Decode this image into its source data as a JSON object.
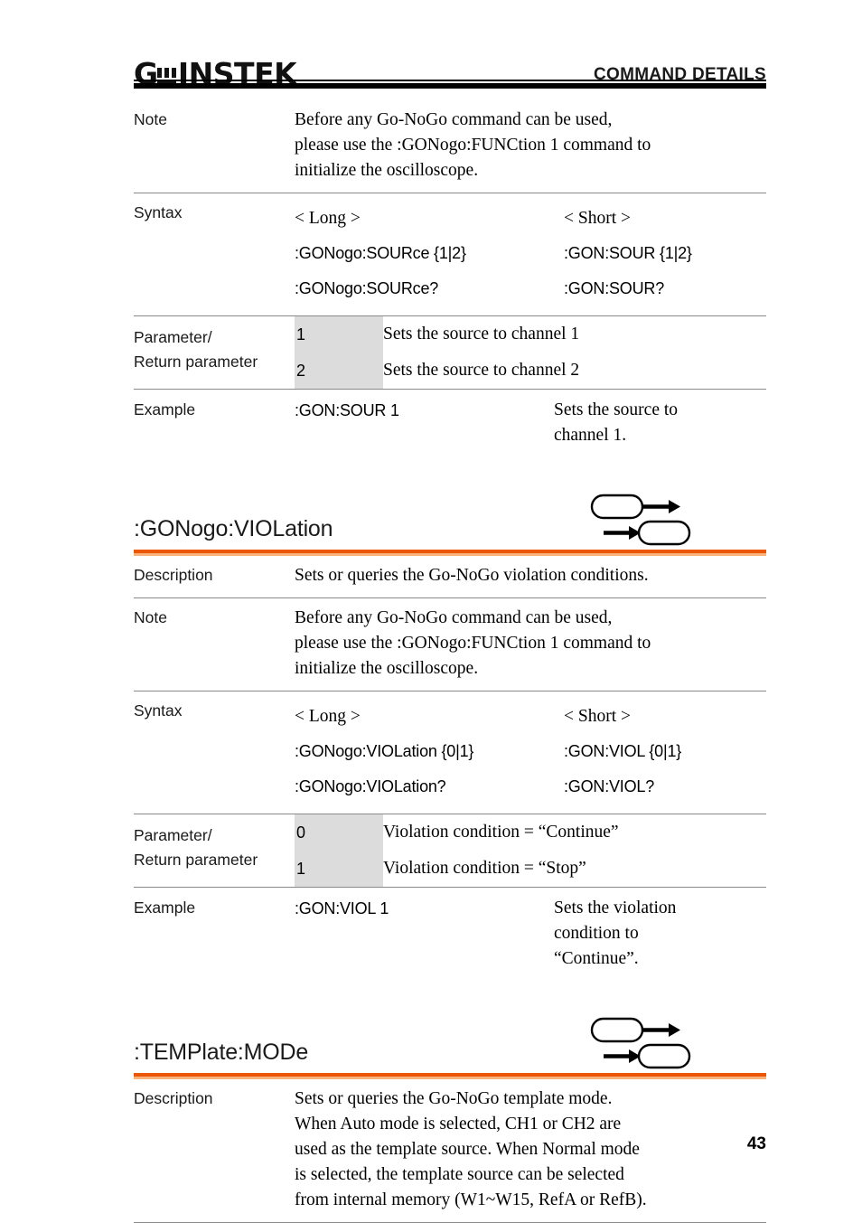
{
  "header": {
    "logo_g": "G",
    "logo_rest": "INSTEK",
    "logo_alt": "GW INSTEK",
    "title": "COMMAND DETAILS"
  },
  "footer": {
    "page_number": "43"
  },
  "colors": {
    "accent_orange": "#ec5607",
    "accent_orange_light": "#f8b37d",
    "param_shade": "#dcdcdc",
    "rule": "#8a8a8a"
  },
  "icons": {
    "set_icon": "set-command-icon",
    "query_icon": "query-command-icon"
  },
  "labels": {
    "description": "Description",
    "note": "Note",
    "syntax": "Syntax",
    "parameter": "Parameter/",
    "return_parameter": "Return parameter",
    "example": "Example",
    "long_header": "< Long >",
    "short_header": "< Short >"
  },
  "source_command": {
    "note_lines": [
      "Before any Go-NoGo command can be used,",
      "please use the :GONogo:FUNCtion 1 command to",
      "initialize the oscilloscope."
    ],
    "syntax": [
      {
        "long": ":GONogo:SOURce {1|2}",
        "short": ":GON:SOUR {1|2}"
      },
      {
        "long": ":GONogo:SOURce?",
        "short": ":GON:SOUR?"
      }
    ],
    "parameters": [
      {
        "value": "1",
        "desc": "Sets the source to channel 1"
      },
      {
        "value": "2",
        "desc": "Sets the source to channel 2"
      }
    ],
    "example": {
      "command": ":GON:SOUR 1",
      "desc_lines": [
        "Sets the source to",
        "channel 1."
      ]
    }
  },
  "violation_command": {
    "title": ":GONogo:VIOLation",
    "description": "Sets or queries the Go-NoGo violation conditions.",
    "note_lines": [
      "Before any Go-NoGo command can be used,",
      "please use the :GONogo:FUNCtion 1 command to",
      "initialize the oscilloscope."
    ],
    "syntax": [
      {
        "long": ":GONogo:VIOLation {0|1}",
        "short": ":GON:VIOL {0|1}"
      },
      {
        "long": ":GONogo:VIOLation?",
        "short": ":GON:VIOL?"
      }
    ],
    "parameters": [
      {
        "value": "0",
        "desc": "Violation condition = “Continue”"
      },
      {
        "value": "1",
        "desc": "Violation condition = “Stop”"
      }
    ],
    "example": {
      "command": ":GON:VIOL 1",
      "desc_lines": [
        "Sets the violation",
        "condition to",
        "“Continue”."
      ]
    }
  },
  "template_command": {
    "title": ":TEMPlate:MODe",
    "description_lines": [
      "Sets or queries the Go-NoGo template mode.",
      "When Auto mode is selected, CH1 or CH2 are",
      "used as the template source. When Normal mode",
      "is selected, the template source can be selected",
      "from internal memory (W1~W15, RefA or RefB)."
    ]
  }
}
